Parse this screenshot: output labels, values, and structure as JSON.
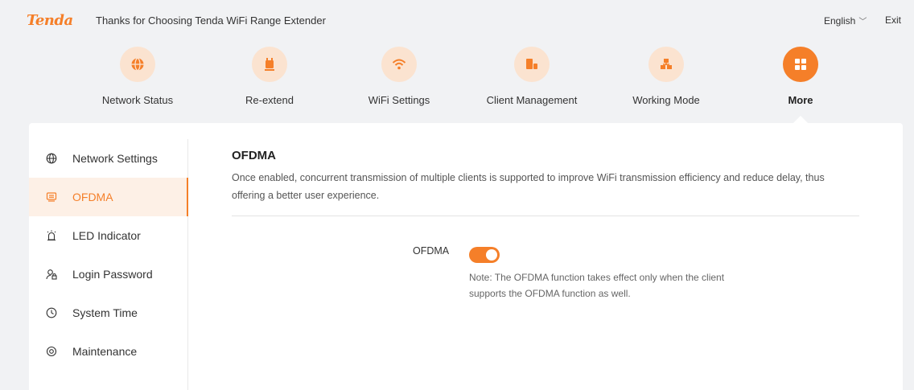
{
  "header": {
    "logo": "Tenda",
    "tagline": "Thanks for Choosing Tenda WiFi Range Extender",
    "language": "English",
    "exit": "Exit"
  },
  "nav": [
    {
      "label": "Network Status",
      "icon": "globe-icon"
    },
    {
      "label": "Re-extend",
      "icon": "extender-icon"
    },
    {
      "label": "WiFi Settings",
      "icon": "wifi-icon"
    },
    {
      "label": "Client Management",
      "icon": "client-icon"
    },
    {
      "label": "Working Mode",
      "icon": "mode-icon"
    },
    {
      "label": "More",
      "icon": "grid-icon",
      "active": true
    }
  ],
  "sidebar": {
    "items": [
      {
        "label": "Network Settings",
        "icon": "globe-icon"
      },
      {
        "label": "OFDMA",
        "icon": "ofdma-icon",
        "active": true
      },
      {
        "label": "LED Indicator",
        "icon": "led-icon"
      },
      {
        "label": "Login Password",
        "icon": "user-lock-icon"
      },
      {
        "label": "System Time",
        "icon": "clock-icon"
      },
      {
        "label": "Maintenance",
        "icon": "maintenance-icon"
      }
    ]
  },
  "main": {
    "title": "OFDMA",
    "description": "Once enabled, concurrent transmission of multiple clients is supported to improve WiFi transmission efficiency and reduce delay, thus offering a better user experience.",
    "setting_label": "OFDMA",
    "toggle_on": true,
    "note": "Note: The OFDMA function takes effect only when the client supports the OFDMA function as well."
  },
  "colors": {
    "accent": "#f57f29",
    "accent_light": "#fbe3d0",
    "background": "#f1f2f4"
  }
}
